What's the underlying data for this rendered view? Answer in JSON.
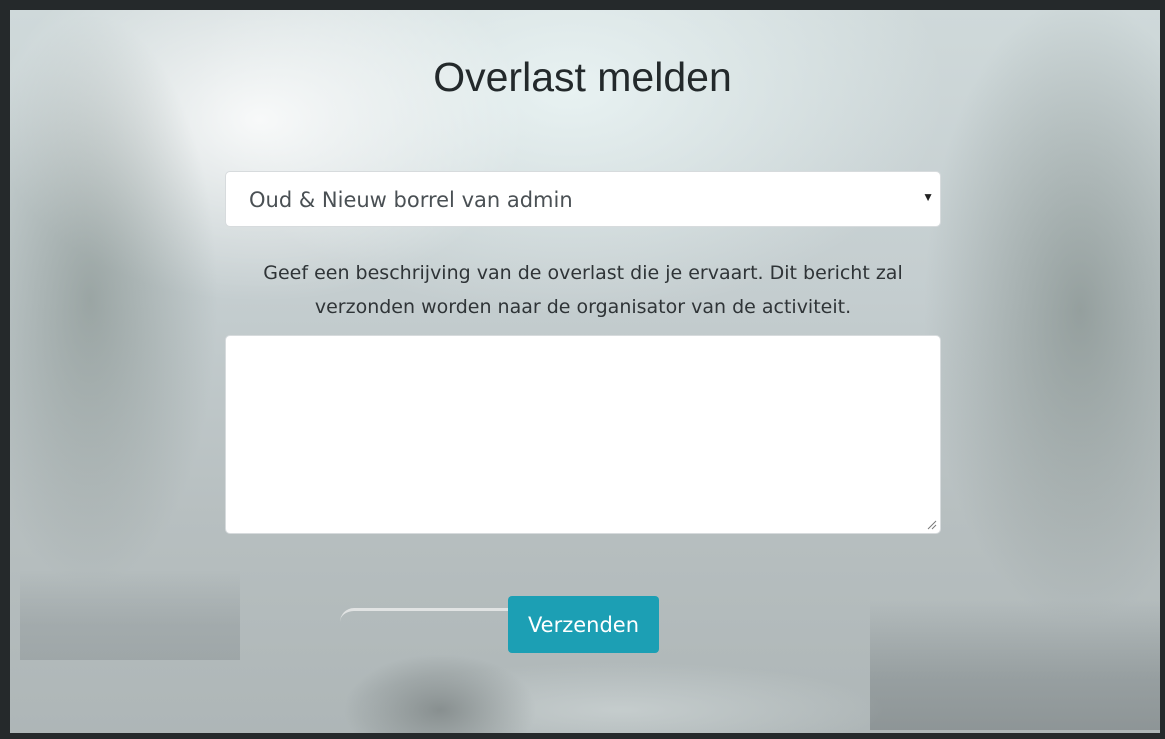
{
  "page": {
    "title": "Overlast melden"
  },
  "form": {
    "activity_select": {
      "selected": "Oud & Nieuw borrel van admin"
    },
    "description": "Geef een beschrijving van de overlast die je ervaart. Dit bericht zal verzonden worden naar de organisator van de activiteit.",
    "message": {
      "value": ""
    },
    "submit_label": "Verzenden"
  },
  "icons": {
    "select_caret": "caret-down-icon",
    "resize_grip": "resize-grip-icon"
  },
  "colors": {
    "button": "#1c9fb4",
    "frame": "#25292b",
    "title": "#23292b"
  }
}
